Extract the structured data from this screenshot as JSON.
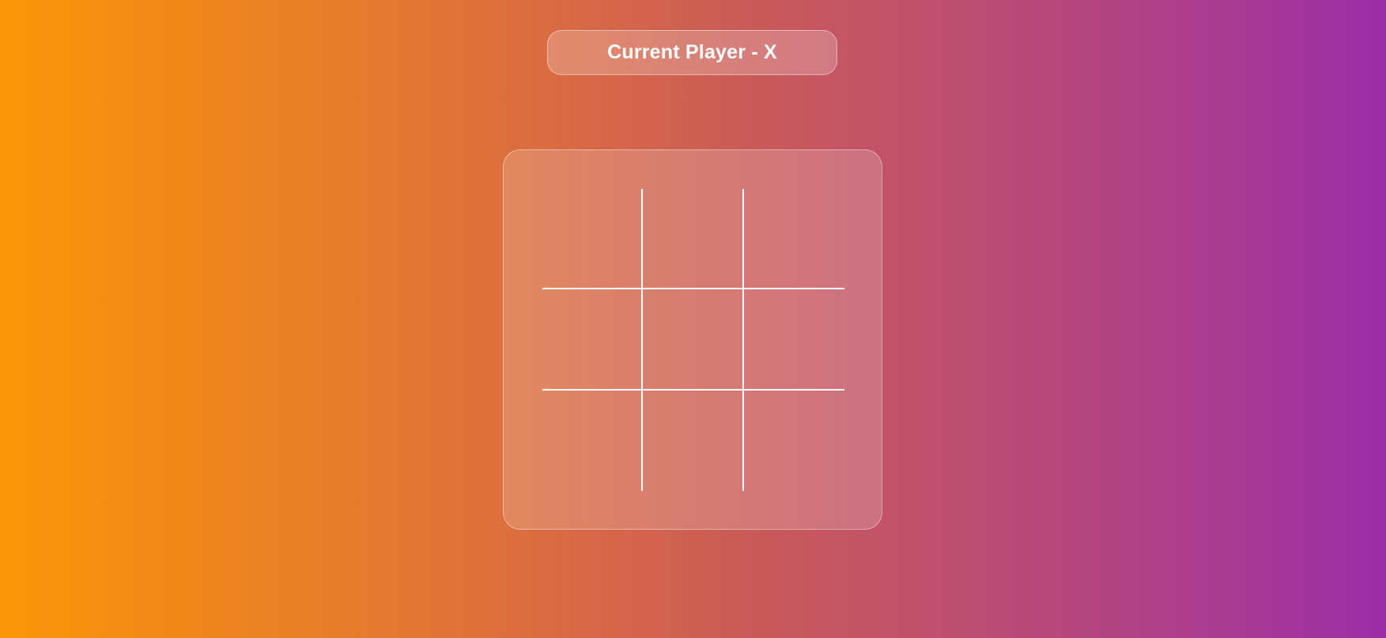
{
  "status": {
    "label": "Current Player - X"
  },
  "board": {
    "cells": [
      "",
      "",
      "",
      "",
      "",
      "",
      "",
      "",
      ""
    ]
  },
  "colors": {
    "gradient_start": "#fb9607",
    "gradient_end": "#9c2ea8",
    "grid_line": "#ffffff"
  }
}
